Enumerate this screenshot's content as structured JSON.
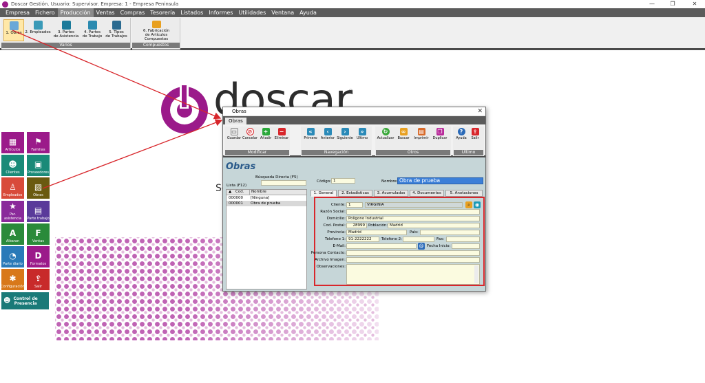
{
  "window": {
    "title": "Doscar Gestión. Usuario: Supervisor. Empresa: 1 - Empresa Peninsula",
    "minimize": "—",
    "maximize": "❐",
    "close": "✕"
  },
  "menu": [
    "Empresa",
    "Fichero",
    "Producción",
    "Ventas",
    "Compras",
    "Tesorería",
    "Listados",
    "Informes",
    "Utilidades",
    "Ventana",
    "Ayuda"
  ],
  "ribbon": {
    "varios_label": "Varios",
    "compuestos_label": "Compuestos",
    "buttons": [
      {
        "line1": "1. Obras",
        "line2": ""
      },
      {
        "line1": "2. Empleados",
        "line2": ""
      },
      {
        "line1": "3. Partes",
        "line2": "de Asistencia"
      },
      {
        "line1": "4. Partes",
        "line2": "de Trabajo"
      },
      {
        "line1": "5. Tipos",
        "line2": "de Trabajos"
      },
      {
        "line1": "6. Fabricación",
        "line2": "de Artículos Compuestos"
      }
    ]
  },
  "logo": {
    "text": "doscar",
    "mark": "®"
  },
  "bg_text": "So",
  "tiles": [
    {
      "label": "Artículos",
      "color": "#9b1a8a",
      "glyph": "▦"
    },
    {
      "label": "Familias",
      "color": "#9b1a8a",
      "glyph": "⚑"
    },
    {
      "label": "Clientes",
      "color": "#1a8a78",
      "glyph": "☻"
    },
    {
      "label": "Proveedores",
      "color": "#1a8a78",
      "glyph": "▣"
    },
    {
      "label": "Empleados",
      "color": "#d84a3a",
      "glyph": "♙"
    },
    {
      "label": "Obras",
      "color": "#6a5a10",
      "glyph": "▨"
    },
    {
      "label": "Par. asistencia",
      "color": "#8a2a9a",
      "glyph": "★"
    },
    {
      "label": "Parte trabajo",
      "color": "#5a3a9a",
      "glyph": "▤"
    },
    {
      "label": "Albaran",
      "color": "#2a8a3a",
      "glyph": "A"
    },
    {
      "label": "Ventas",
      "color": "#2a8a3a",
      "glyph": "F"
    },
    {
      "label": "Parte diario",
      "color": "#2a7ab8",
      "glyph": "◔"
    },
    {
      "label": "Formatos",
      "color": "#9b1a8a",
      "glyph": "D"
    },
    {
      "label": "Configuración",
      "color": "#d8781a",
      "glyph": "✱"
    },
    {
      "label": "Salir",
      "color": "#c82a2a",
      "glyph": "⇪"
    }
  ],
  "presence_tile": {
    "line1": "Control de",
    "line2": "Presencia",
    "color": "#1a7a78"
  },
  "dialog": {
    "title": "Obras",
    "close": "✕",
    "tab": "Obras",
    "heading": "Obras",
    "groups": {
      "modificar": "Modificar",
      "navegacion": "Navegación",
      "otros": "Otros",
      "ultimo": "Ultimo"
    },
    "buttons": {
      "modificar": [
        "Guardar",
        "Cancelar",
        "Añadir",
        "Eliminar"
      ],
      "navegacion": [
        "Primero",
        "Anterior",
        "Siguiente",
        "Ultimo"
      ],
      "otros": [
        "Actualizar",
        "Buscar",
        "Imprimir",
        "Duplicar"
      ],
      "ultimo": [
        "Ayuda",
        "Salir"
      ]
    },
    "busqueda_label": "Búsqueda Directa (F5)",
    "lista_label": "Lista (F12)",
    "codigo_label": "Código:",
    "codigo_value": "1",
    "nombre_label": "Nombre:",
    "nombre_value": "Obra de prueba",
    "list": {
      "headers": [
        "Cod.",
        "Nombre"
      ],
      "rows": [
        {
          "cod": "000000",
          "nombre": "[Ninguna]"
        },
        {
          "cod": "000001",
          "nombre": "Obra de prueba"
        }
      ]
    },
    "form_tabs": [
      "1. General",
      "2. Estadísticas",
      "3. Acumulados",
      "4. Documentos",
      "5. Anotaciones"
    ],
    "form": {
      "cliente_label": "Cliente:",
      "cliente_code": "1",
      "cliente_name": "VIRGINIA",
      "razon_label": "Razón Social:",
      "domicilio_label": "Domicilio:",
      "domicilio_value": "Polígono Industrial",
      "cp_label": "Cod. Postal:",
      "cp_value": "28999",
      "poblacion_label": "Población:",
      "poblacion_value": "Madrid",
      "provincia_label": "Provincia:",
      "provincia_value": "Madrid",
      "pais_label": "País:",
      "tel1_label": "Telefono 1:",
      "tel1_value": "91-2222222",
      "tel2_label": "Telefono 2:",
      "fax_label": "Fax:",
      "email_label": "E-Mail:",
      "fecha_label": "Fecha Inicio:",
      "contacto_label": "Persona Contacto:",
      "imagen_label": "Archivo Imagen:",
      "obs_label": "Observaciones:"
    }
  }
}
